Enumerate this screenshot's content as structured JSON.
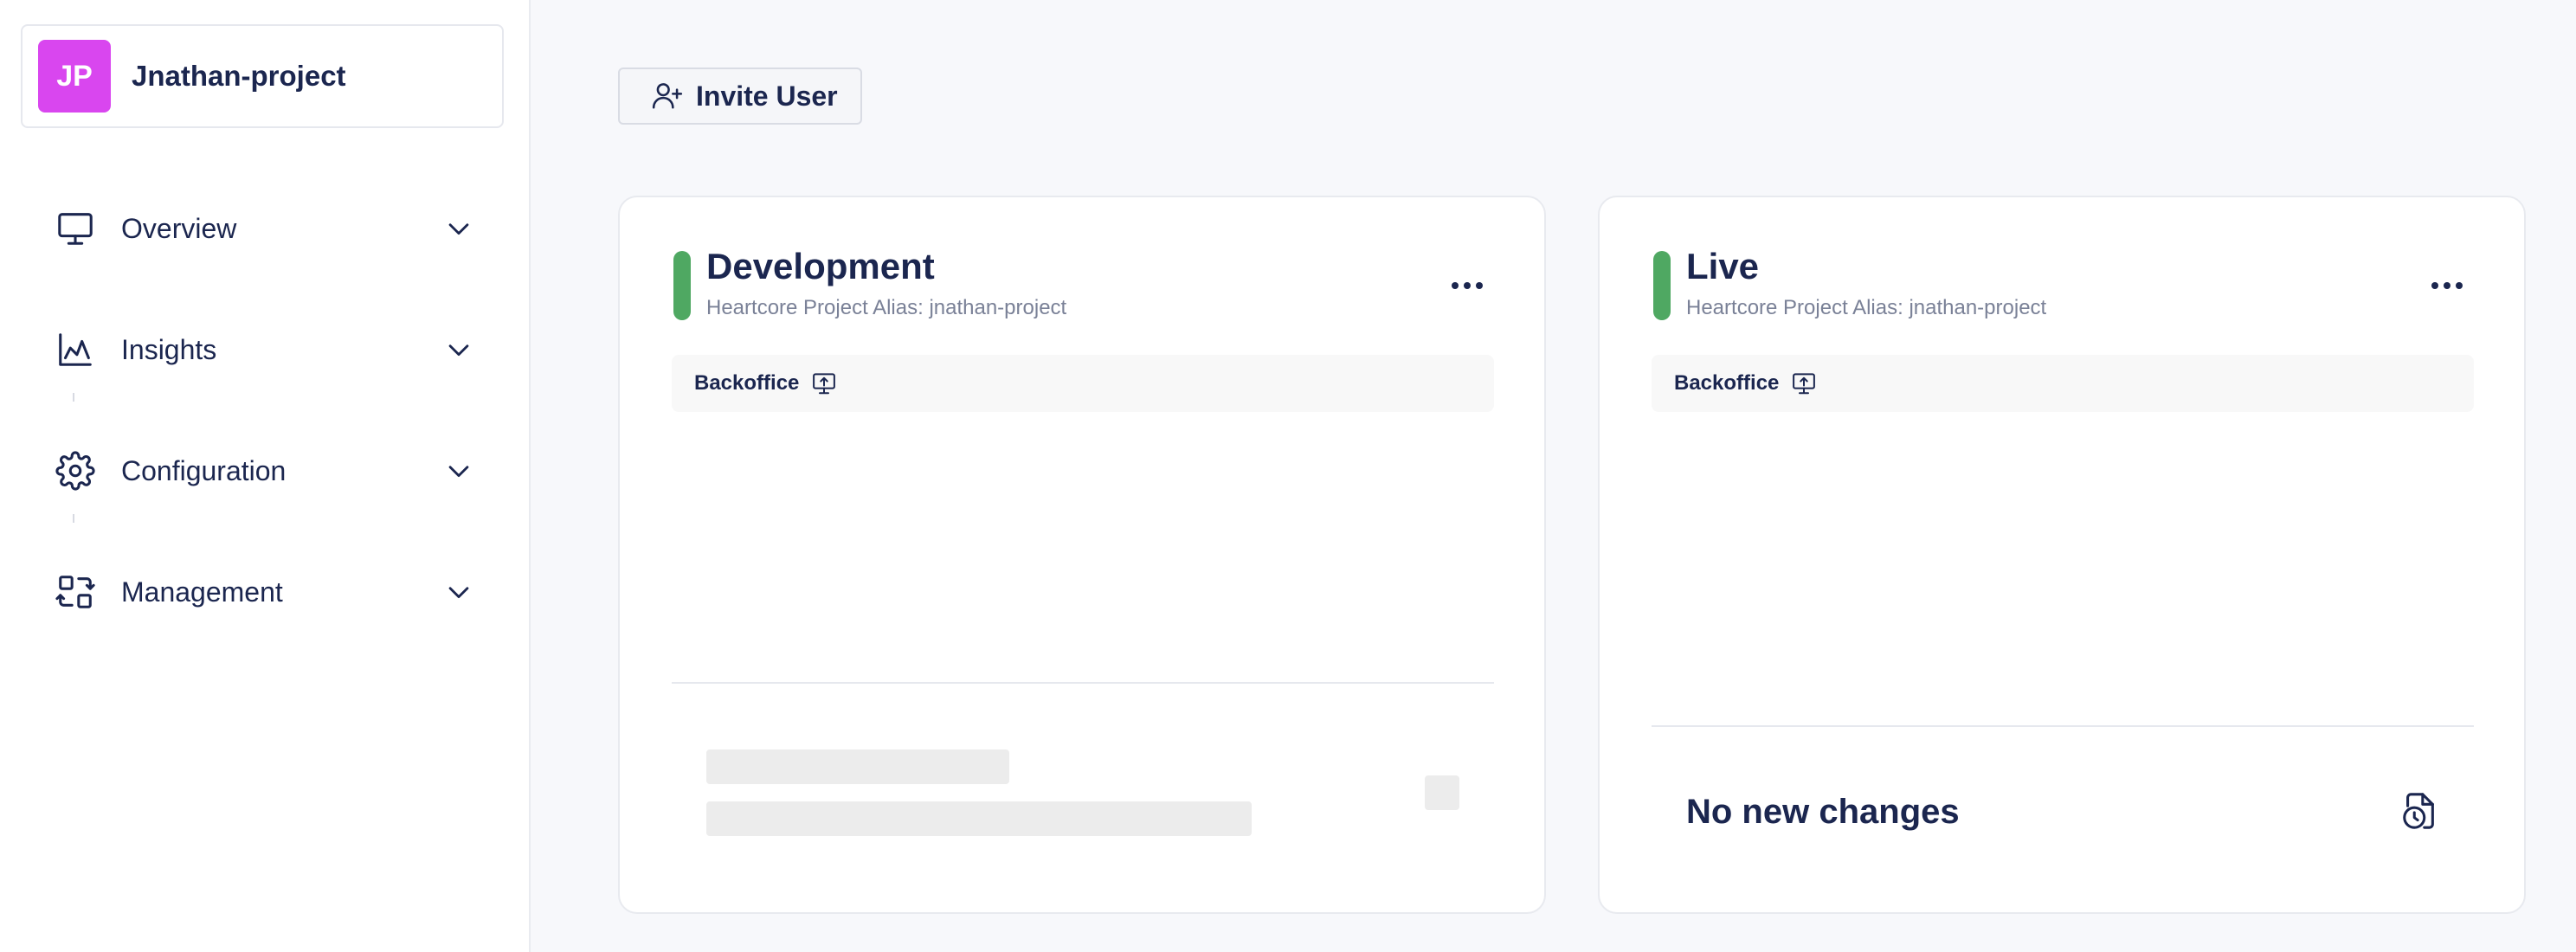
{
  "sidebar": {
    "project": {
      "initials": "JP",
      "name": "Jnathan-project",
      "avatar_color": "#d946ef"
    },
    "items": [
      {
        "label": "Overview",
        "icon": "monitor-icon"
      },
      {
        "label": "Insights",
        "icon": "chart-icon"
      },
      {
        "label": "Configuration",
        "icon": "gear-icon"
      },
      {
        "label": "Management",
        "icon": "management-icon"
      }
    ]
  },
  "toolbar": {
    "invite_label": "Invite User"
  },
  "environments": [
    {
      "title": "Development",
      "alias": "Heartcore Project Alias: jnathan-project",
      "status_color": "#4fa862",
      "backoffice_label": "Backoffice",
      "state": "loading"
    },
    {
      "title": "Live",
      "alias": "Heartcore Project Alias: jnathan-project",
      "status_color": "#4fa862",
      "backoffice_label": "Backoffice",
      "changes_text": "No new changes"
    }
  ],
  "colors": {
    "text": "#1b264f",
    "muted": "#7a8197",
    "accent_green": "#4fa862",
    "background": "#f7f8fb"
  }
}
